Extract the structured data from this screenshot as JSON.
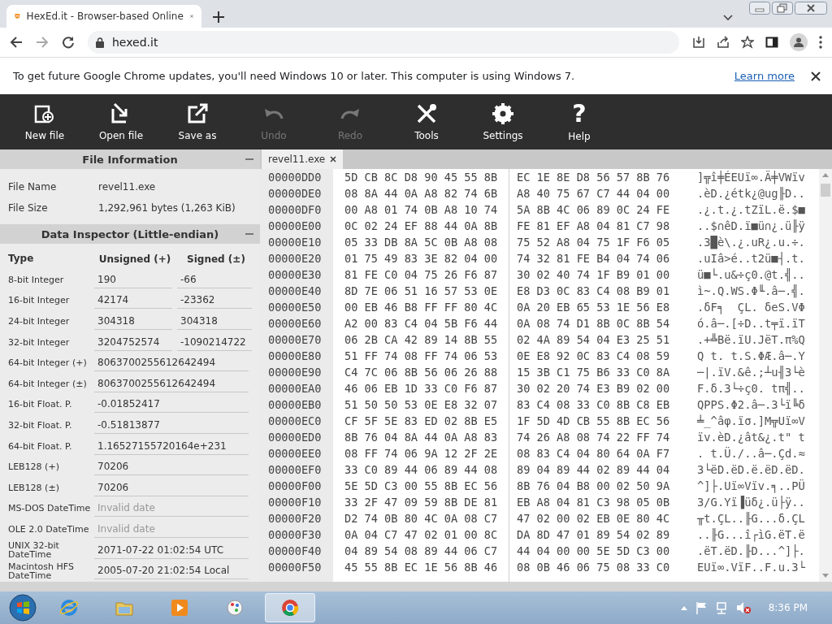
{
  "browser": {
    "tab_title": "HexEd.it - Browser-based Online",
    "url": "hexed.it"
  },
  "infobar": {
    "message": "To get future Google Chrome updates, you'll need Windows 10 or later. This computer is using Windows 7.",
    "link": "Learn more"
  },
  "toolbar": [
    {
      "label": "New file",
      "disabled": false
    },
    {
      "label": "Open file",
      "disabled": false
    },
    {
      "label": "Save as",
      "disabled": false
    },
    {
      "label": "Undo",
      "disabled": true
    },
    {
      "label": "Redo",
      "disabled": true
    },
    {
      "label": "Tools",
      "disabled": false
    },
    {
      "label": "Settings",
      "disabled": false
    },
    {
      "label": "Help",
      "glyph": "?",
      "disabled": false
    }
  ],
  "file_info": {
    "title": "File Information",
    "rows": [
      {
        "label": "File Name",
        "value": "revel11.exe"
      },
      {
        "label": "File Size",
        "value": "1,292,961 bytes (1,263 KiB)"
      }
    ]
  },
  "inspector": {
    "title": "Data Inspector (Little-endian)",
    "columns": [
      "Type",
      "Unsigned (+)",
      "Signed (±)"
    ],
    "rows": [
      {
        "kind": "pair",
        "label": "8-bit Integer",
        "unsigned": "190",
        "signed": "-66"
      },
      {
        "kind": "pair",
        "label": "16-bit Integer",
        "unsigned": "42174",
        "signed": "-23362"
      },
      {
        "kind": "pair",
        "label": "24-bit Integer",
        "unsigned": "304318",
        "signed": "304318"
      },
      {
        "kind": "pair",
        "label": "32-bit Integer",
        "unsigned": "3204752574",
        "signed": "-1090214722"
      },
      {
        "kind": "wide",
        "label": "64-bit Integer (+)",
        "value": "8063700255612642494"
      },
      {
        "kind": "wide",
        "label": "64-bit Integer (±)",
        "value": "8063700255612642494"
      },
      {
        "kind": "wide",
        "label": "16-bit Float. P.",
        "value": "-0.01852417"
      },
      {
        "kind": "wide",
        "label": "32-bit Float. P.",
        "value": "-0.51813877"
      },
      {
        "kind": "wide",
        "label": "64-bit Float. P.",
        "value": "1.16527155720164e+231"
      },
      {
        "kind": "wide",
        "label": "LEB128 (+)",
        "value": "70206"
      },
      {
        "kind": "wide",
        "label": "LEB128 (±)",
        "value": "70206"
      },
      {
        "kind": "empty",
        "label": "MS-DOS DateTime",
        "placeholder": "Invalid date"
      },
      {
        "kind": "empty",
        "label": "OLE 2.0 DateTime",
        "placeholder": "Invalid date"
      },
      {
        "kind": "wide",
        "label": "UNIX 32-bit DateTime",
        "value": "2071-07-22 01:02:54 UTC"
      },
      {
        "kind": "wide",
        "label": "Macintosh HFS DateTime",
        "value": "2005-07-20 21:02:54 Local"
      }
    ]
  },
  "editor": {
    "tabs": [
      {
        "label": "revel11.exe",
        "selected": true
      }
    ],
    "rows": [
      {
        "offset": "00000DD0",
        "hex_left": "5D CB 8C D8 90 45 55 8B",
        "hex_right": "EC 1E 8E D8 56 57 8B 76",
        "text": "]╦î╪ÉEUï∞.Ä╪VWïv"
      },
      {
        "offset": "00000DE0",
        "hex_left": "08 8A 44 0A A8 82 74 6B",
        "hex_right": "A8 40 75 67 C7 44 04 00",
        "text": ".èD.¿étk¿@ug╟D.."
      },
      {
        "offset": "00000DF0",
        "hex_left": "00 A8 01 74 0B A8 10 74",
        "hex_right": "5A 8B 4C 06 89 0C 24 FE",
        "text": ".¿.t.¿.tZïL.ë.$■"
      },
      {
        "offset": "00000E00",
        "hex_left": "0C 02 24 EF 88 44 0A 8B",
        "hex_right": "FE 81 EF A8 04 81 C7 98",
        "text": "..$∩êD.ï■ü∩¿.ü╟ÿ"
      },
      {
        "offset": "00000E10",
        "hex_left": "05 33 DB 8A 5C 0B A8 08",
        "hex_right": "75 52 A8 04 75 1F F6 05",
        "text": ".3█è\\.¿.uR¿.u.÷."
      },
      {
        "offset": "00000E20",
        "hex_left": "01 75 49 83 3E 82 04 00",
        "hex_right": "74 32 81 FE B4 04 74 06",
        "text": ".uIâ>é..t2ü■┤.t."
      },
      {
        "offset": "00000E30",
        "hex_left": "81 FE C0 04 75 26 F6 87",
        "hex_right": "30 02 40 74 1F B9 01 00",
        "text": "ü■└.u&÷ç0.@t.╣.."
      },
      {
        "offset": "00000E40",
        "hex_left": "8D 7E 06 51 16 57 53 0E",
        "hex_right": "E8 D3 0C 83 C4 08 B9 01",
        "text": "ì~.Q.WS.Φ╙.â─.╣."
      },
      {
        "offset": "00000E50",
        "hex_left": "00 EB 46 B8 FF FF 80 4C",
        "hex_right": "0A 20 EB 65 53 1E 56 E8",
        "text": ".δF╕  ÇL. δeS.VΦ"
      },
      {
        "offset": "00000E60",
        "hex_left": "A2 00 83 C4 04 5B F6 44",
        "hex_right": "0A 08 74 D1 8B 0C 8B 54",
        "text": "ó.â─.[÷D..t╤ï.ïT"
      },
      {
        "offset": "00000E70",
        "hex_left": "06 2B CA 42 89 14 8B 55",
        "hex_right": "02 4A 89 54 04 E3 25 51",
        "text": ".+╩Bë.ïU.JëT.π%Q"
      },
      {
        "offset": "00000E80",
        "hex_left": "51 FF 74 08 FF 74 06 53",
        "hex_right": "0E E8 92 0C 83 C4 08 59",
        "text": "Q t. t.S.ΦÆ.â─.Y"
      },
      {
        "offset": "00000E90",
        "hex_left": "C4 7C 06 8B 56 06 26 88",
        "hex_right": "15 3B C1 75 B6 33 C0 8A",
        "text": "─|.ïV.&ê.;┴u╢3└è"
      },
      {
        "offset": "00000EA0",
        "hex_left": "46 06 EB 1D 33 C0 F6 87",
        "hex_right": "30 02 20 74 E3 B9 02 00",
        "text": "F.δ.3└÷ç0. tπ╣.."
      },
      {
        "offset": "00000EB0",
        "hex_left": "51 50 50 53 0E E8 32 07",
        "hex_right": "83 C4 08 33 C0 8B C8 EB",
        "text": "QPPS.Φ2.â─.3└ï╚δ"
      },
      {
        "offset": "00000EC0",
        "hex_left": "CF 5F 5E 83 ED 02 8B E5",
        "hex_right": "1F 5D 4D CB 55 8B EC 56",
        "text": "╧_^âφ.ïσ.]M╦Uï∞V"
      },
      {
        "offset": "00000ED0",
        "hex_left": "8B 76 04 8A 44 0A A8 83",
        "hex_right": "74 26 A8 08 74 22 FF 74",
        "text": "ïv.èD.¿ât&¿.t\" t"
      },
      {
        "offset": "00000EE0",
        "hex_left": "08 FF 74 06 9A 12 2F 2E",
        "hex_right": "08 83 C4 04 80 64 0A F7",
        "text": ". t.Ü./..â─.Çd.≈"
      },
      {
        "offset": "00000EF0",
        "hex_left": "33 C0 89 44 06 89 44 08",
        "hex_right": "89 04 89 44 02 89 44 04",
        "text": "3└ëD.ëD.ë.ëD.ëD."
      },
      {
        "offset": "00000F00",
        "hex_left": "5E 5D C3 00 55 8B EC 56",
        "hex_right": "8B 76 04 B8 00 02 50 9A",
        "text": "^]├.Uï∞Vïv.╕..PÜ"
      },
      {
        "offset": "00000F10",
        "hex_left": "33 2F 47 09 59 8B DE 81",
        "hex_right": "EB A8 04 81 C3 98 05 0B",
        "text": "3/G.Yï▐üδ¿.ü├ÿ.."
      },
      {
        "offset": "00000F20",
        "hex_left": "D2 74 0B 80 4C 0A 08 C7",
        "hex_right": "47 02 00 02 EB 0E 80 4C",
        "text": "╥t.ÇL..╟G...δ.ÇL"
      },
      {
        "offset": "00000F30",
        "hex_left": "0A 04 C7 47 02 01 00 8C",
        "hex_right": "DA 8D 47 01 89 54 02 89",
        "text": "..╟G...î┌ìG.ëT.ë"
      },
      {
        "offset": "00000F40",
        "hex_left": "04 89 54 08 89 44 06 C7",
        "hex_right": "44 04 00 00 5E 5D C3 00",
        "text": ".ëT.ëD.╟D...^]├."
      },
      {
        "offset": "00000F50",
        "hex_left": "45 55 8B EC 1E 56 8B 46",
        "hex_right": "08 0B 46 06 75 08 33 C0",
        "text": "EUï∞.VïF..F.u.3└"
      }
    ]
  },
  "taskbar": {
    "clock": "8:36 PM",
    "apps": [
      {
        "selected": false
      },
      {
        "selected": false
      },
      {
        "selected": false
      },
      {
        "selected": false
      },
      {
        "selected": true
      }
    ]
  }
}
